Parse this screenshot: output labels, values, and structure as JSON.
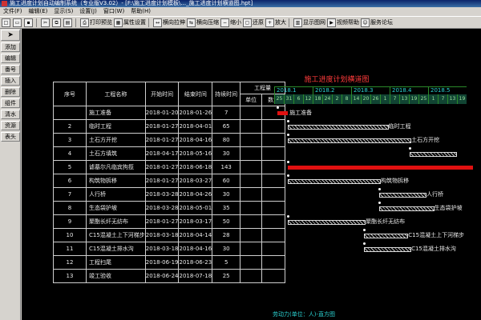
{
  "window": {
    "title": "施工进度计划自动编制系统（专业版V3.02）- [F:\\施工进度计划模板\\..._施工进度计划横道图.hpt]"
  },
  "menu": [
    "文件(F)",
    "编辑(E)",
    "显示(S)",
    "设置(J)",
    "窗口(W)",
    "帮助(H)"
  ],
  "toolbar": {
    "print_preview": "打印预览",
    "properties": "属性设置",
    "h_stretch": "横向拉伸",
    "h_compress": "横向压缩",
    "zoom_out": "缩小",
    "restore": "还原",
    "zoom_in": "放大",
    "show_net": "显示图网",
    "video_help": "视频帮助",
    "forum": "服务论坛"
  },
  "leftpanel": [
    "添加",
    "编辑",
    "插入",
    "删除",
    "组件",
    "清水",
    "资源",
    "表头"
  ],
  "left_extra": "番号",
  "chart": {
    "title": "施工进度计划横道图",
    "headers": {
      "seq": "序号",
      "name": "工程名称",
      "start": "开始时间",
      "end": "结束时间",
      "duration": "持续时间",
      "quantity": "工程量",
      "unit": "单位",
      "qty": "数量"
    },
    "months": [
      "2018.1",
      "2018.2",
      "2018.3",
      "2018.4",
      "2018.5"
    ],
    "days": [
      "25",
      "31",
      "6",
      "12",
      "18",
      "24",
      "2",
      "8",
      "14",
      "20",
      "26",
      "1",
      "7",
      "13",
      "19",
      "25",
      "1",
      "7",
      "13",
      "19"
    ],
    "rows": [
      {
        "seq": "",
        "name": "施工准备",
        "start": "2018-01-20",
        "end": "2018-01-26",
        "dur": "7"
      },
      {
        "seq": "2",
        "name": "临时工程",
        "start": "2018-01-27",
        "end": "2018-04-01",
        "dur": "65"
      },
      {
        "seq": "3",
        "name": "土石方开挖",
        "start": "2018-01-27",
        "end": "2018-04-16",
        "dur": "80"
      },
      {
        "seq": "4",
        "name": "土石方填筑",
        "start": "2018-04-17",
        "end": "2018-05-16",
        "dur": "30"
      },
      {
        "seq": "5",
        "name": "谑墓尔凡临宾拘揽",
        "start": "2018-01-27",
        "end": "2018-06-18",
        "dur": "143"
      },
      {
        "seq": "6",
        "name": "构筑物拆移",
        "start": "2018-01-27",
        "end": "2018-03-27",
        "dur": "60"
      },
      {
        "seq": "7",
        "name": "人行桥",
        "start": "2018-03-28",
        "end": "2018-04-26",
        "dur": "30"
      },
      {
        "seq": "8",
        "name": "生态袋护坡",
        "start": "2018-03-28",
        "end": "2018-05-01",
        "dur": "35"
      },
      {
        "seq": "9",
        "name": "聚酯长纤无纺布",
        "start": "2018-01-27",
        "end": "2018-03-17",
        "dur": "50"
      },
      {
        "seq": "10",
        "name": "C15混凝土上下河梯步",
        "start": "2018-03-18",
        "end": "2018-04-14",
        "dur": "28"
      },
      {
        "seq": "11",
        "name": "C15混凝土排水沟",
        "start": "2018-03-18",
        "end": "2018-04-16",
        "dur": "30"
      },
      {
        "seq": "12",
        "name": "工程扫尾",
        "start": "2018-06-19",
        "end": "2018-06-23",
        "dur": "5"
      },
      {
        "seq": "13",
        "name": "竣工验收",
        "start": "2018-06-24",
        "end": "2018-07-18",
        "dur": "25"
      }
    ],
    "bar_labels": [
      "施工准备",
      "临时工程",
      "土石方开挖",
      "土石方填筑",
      "构筑物拆移",
      "人行桥",
      "生态袋护坡",
      "聚酯长纤无纺布",
      "C15混凝土上下河梯步",
      "C15混凝土排水沟"
    ],
    "footer": "劳动力(单位：人)-直方图"
  },
  "colors": {
    "title_red": "#ff3b3b",
    "bar_red": "#e01010",
    "grid_green": "#2a8a2a",
    "cyan": "#2bd3d3"
  }
}
